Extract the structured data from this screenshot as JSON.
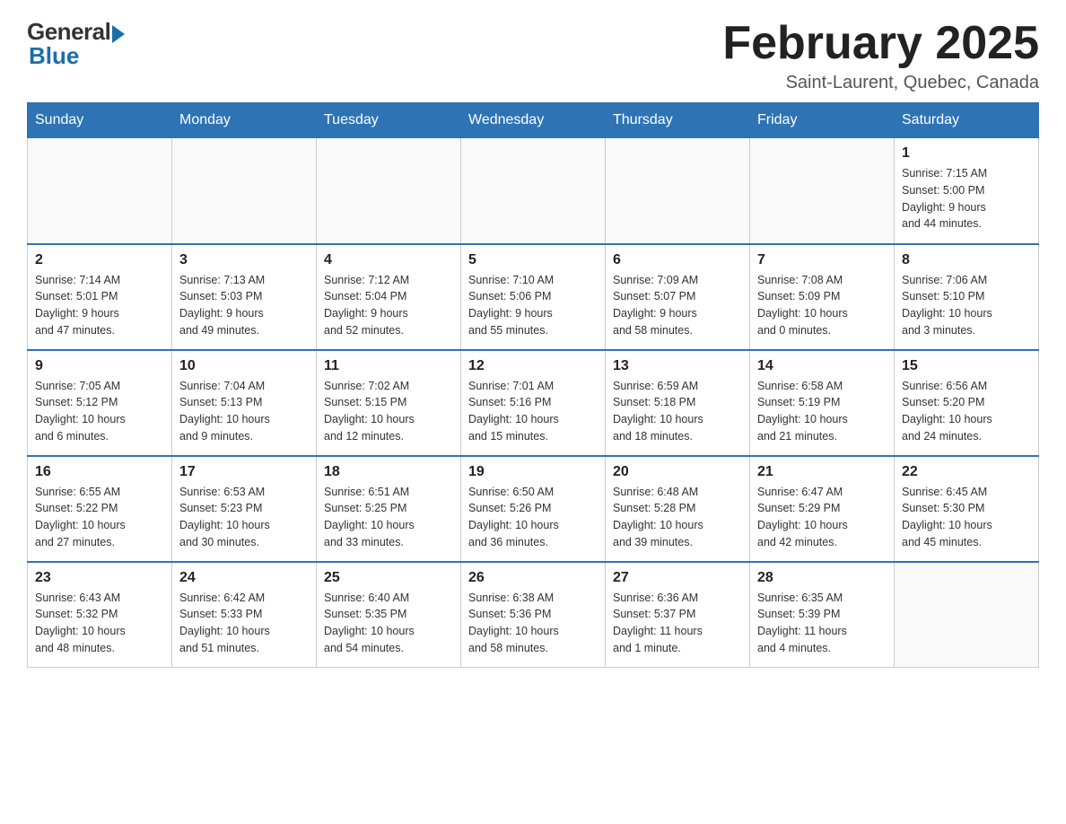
{
  "logo": {
    "general": "General",
    "blue": "Blue"
  },
  "title": "February 2025",
  "location": "Saint-Laurent, Quebec, Canada",
  "days_of_week": [
    "Sunday",
    "Monday",
    "Tuesday",
    "Wednesday",
    "Thursday",
    "Friday",
    "Saturday"
  ],
  "weeks": [
    [
      {
        "day": "",
        "info": ""
      },
      {
        "day": "",
        "info": ""
      },
      {
        "day": "",
        "info": ""
      },
      {
        "day": "",
        "info": ""
      },
      {
        "day": "",
        "info": ""
      },
      {
        "day": "",
        "info": ""
      },
      {
        "day": "1",
        "info": "Sunrise: 7:15 AM\nSunset: 5:00 PM\nDaylight: 9 hours\nand 44 minutes."
      }
    ],
    [
      {
        "day": "2",
        "info": "Sunrise: 7:14 AM\nSunset: 5:01 PM\nDaylight: 9 hours\nand 47 minutes."
      },
      {
        "day": "3",
        "info": "Sunrise: 7:13 AM\nSunset: 5:03 PM\nDaylight: 9 hours\nand 49 minutes."
      },
      {
        "day": "4",
        "info": "Sunrise: 7:12 AM\nSunset: 5:04 PM\nDaylight: 9 hours\nand 52 minutes."
      },
      {
        "day": "5",
        "info": "Sunrise: 7:10 AM\nSunset: 5:06 PM\nDaylight: 9 hours\nand 55 minutes."
      },
      {
        "day": "6",
        "info": "Sunrise: 7:09 AM\nSunset: 5:07 PM\nDaylight: 9 hours\nand 58 minutes."
      },
      {
        "day": "7",
        "info": "Sunrise: 7:08 AM\nSunset: 5:09 PM\nDaylight: 10 hours\nand 0 minutes."
      },
      {
        "day": "8",
        "info": "Sunrise: 7:06 AM\nSunset: 5:10 PM\nDaylight: 10 hours\nand 3 minutes."
      }
    ],
    [
      {
        "day": "9",
        "info": "Sunrise: 7:05 AM\nSunset: 5:12 PM\nDaylight: 10 hours\nand 6 minutes."
      },
      {
        "day": "10",
        "info": "Sunrise: 7:04 AM\nSunset: 5:13 PM\nDaylight: 10 hours\nand 9 minutes."
      },
      {
        "day": "11",
        "info": "Sunrise: 7:02 AM\nSunset: 5:15 PM\nDaylight: 10 hours\nand 12 minutes."
      },
      {
        "day": "12",
        "info": "Sunrise: 7:01 AM\nSunset: 5:16 PM\nDaylight: 10 hours\nand 15 minutes."
      },
      {
        "day": "13",
        "info": "Sunrise: 6:59 AM\nSunset: 5:18 PM\nDaylight: 10 hours\nand 18 minutes."
      },
      {
        "day": "14",
        "info": "Sunrise: 6:58 AM\nSunset: 5:19 PM\nDaylight: 10 hours\nand 21 minutes."
      },
      {
        "day": "15",
        "info": "Sunrise: 6:56 AM\nSunset: 5:20 PM\nDaylight: 10 hours\nand 24 minutes."
      }
    ],
    [
      {
        "day": "16",
        "info": "Sunrise: 6:55 AM\nSunset: 5:22 PM\nDaylight: 10 hours\nand 27 minutes."
      },
      {
        "day": "17",
        "info": "Sunrise: 6:53 AM\nSunset: 5:23 PM\nDaylight: 10 hours\nand 30 minutes."
      },
      {
        "day": "18",
        "info": "Sunrise: 6:51 AM\nSunset: 5:25 PM\nDaylight: 10 hours\nand 33 minutes."
      },
      {
        "day": "19",
        "info": "Sunrise: 6:50 AM\nSunset: 5:26 PM\nDaylight: 10 hours\nand 36 minutes."
      },
      {
        "day": "20",
        "info": "Sunrise: 6:48 AM\nSunset: 5:28 PM\nDaylight: 10 hours\nand 39 minutes."
      },
      {
        "day": "21",
        "info": "Sunrise: 6:47 AM\nSunset: 5:29 PM\nDaylight: 10 hours\nand 42 minutes."
      },
      {
        "day": "22",
        "info": "Sunrise: 6:45 AM\nSunset: 5:30 PM\nDaylight: 10 hours\nand 45 minutes."
      }
    ],
    [
      {
        "day": "23",
        "info": "Sunrise: 6:43 AM\nSunset: 5:32 PM\nDaylight: 10 hours\nand 48 minutes."
      },
      {
        "day": "24",
        "info": "Sunrise: 6:42 AM\nSunset: 5:33 PM\nDaylight: 10 hours\nand 51 minutes."
      },
      {
        "day": "25",
        "info": "Sunrise: 6:40 AM\nSunset: 5:35 PM\nDaylight: 10 hours\nand 54 minutes."
      },
      {
        "day": "26",
        "info": "Sunrise: 6:38 AM\nSunset: 5:36 PM\nDaylight: 10 hours\nand 58 minutes."
      },
      {
        "day": "27",
        "info": "Sunrise: 6:36 AM\nSunset: 5:37 PM\nDaylight: 11 hours\nand 1 minute."
      },
      {
        "day": "28",
        "info": "Sunrise: 6:35 AM\nSunset: 5:39 PM\nDaylight: 11 hours\nand 4 minutes."
      },
      {
        "day": "",
        "info": ""
      }
    ]
  ]
}
